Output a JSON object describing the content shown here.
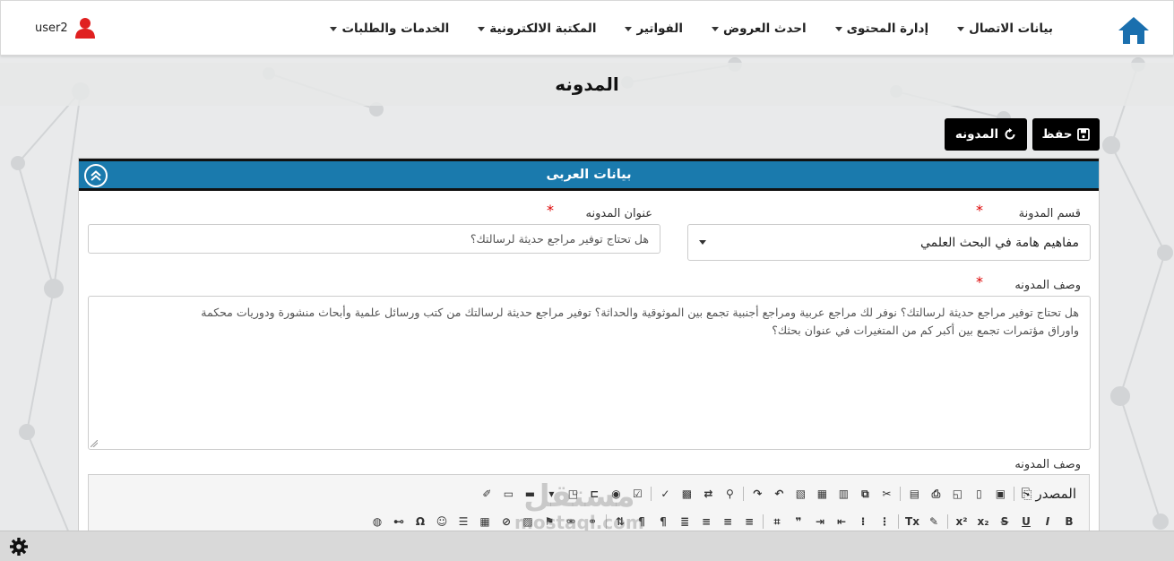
{
  "nav": {
    "items": [
      {
        "label": "الخدمات والطلبات",
        "caret": true
      },
      {
        "label": "المكتبة الالكترونية",
        "caret": true
      },
      {
        "label": "الفواتير",
        "caret": true
      },
      {
        "label": "احدث العروض",
        "caret": true
      },
      {
        "label": "إدارة المحتوى",
        "caret": true
      },
      {
        "label": "بيانات الاتصال",
        "caret": true
      }
    ],
    "user": "user2"
  },
  "page": {
    "title": "المدونه"
  },
  "actions": {
    "save": "حفظ",
    "blog": "المدونه"
  },
  "panel": {
    "title": "بيانات العربى",
    "category_label": "قسم المدونة",
    "category_value": "مفاهيم هامة في البحث العلمي",
    "title_label": "عنوان المدونه",
    "title_value": "هل تحتاج توفير مراجع حديثة لرسالتك؟",
    "desc_label": "وصف المدونه",
    "desc_line1": "هل تحتاج توفير مراجع حديثة لرسالتك؟ نوفر لك مراجع عربية ومراجع أجنبية تجمع بين الموثوقية والحداثة؟ توفير مراجع حديثة لرسالتك من كتب ورسائل علمية وأبحاث منشورة ودوريات محكمة",
    "desc_line2": "واوراق مؤتمرات تجمع بين أكبر كم من المتغيرات في عنوان بحثك؟",
    "editor_label": "وصف المدونه",
    "source_label": "المصدر"
  },
  "watermark": {
    "ar": "مستقل",
    "en": "mostaql.com"
  },
  "colors": {
    "header": "#1a7aad",
    "button": "#000000",
    "required": "#dd0000",
    "home": "#1a6fae",
    "user_icon": "#e02020"
  }
}
